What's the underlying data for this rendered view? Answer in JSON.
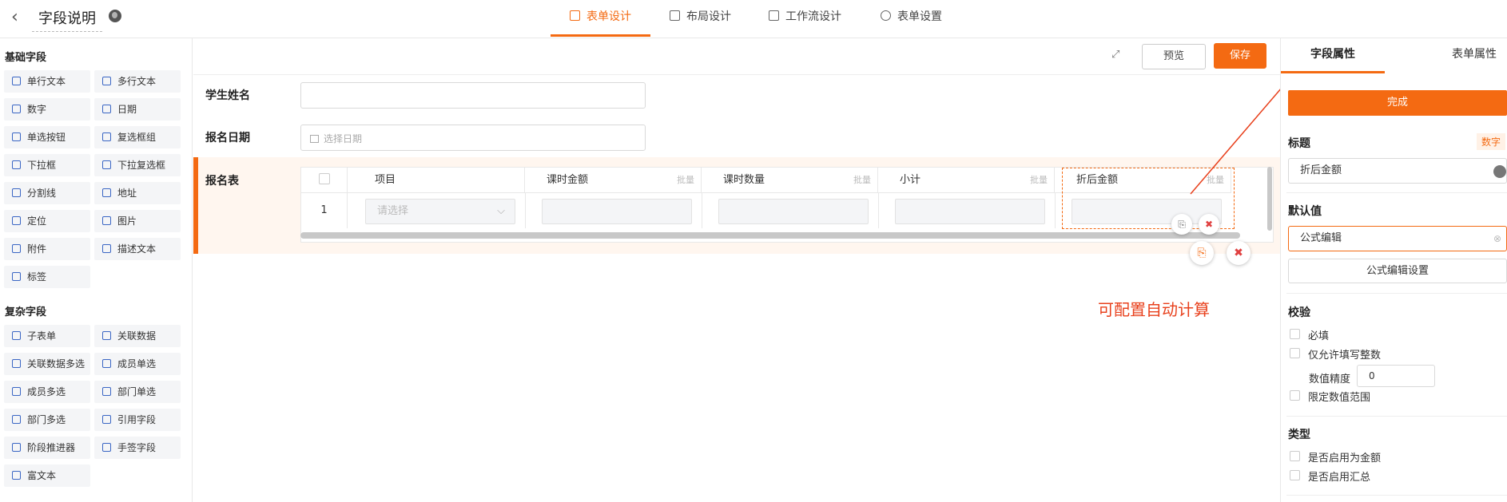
{
  "header": {
    "back_icon": "chevron-left-icon",
    "title": "字段说明",
    "globe_icon": "globe-icon",
    "tabs": [
      {
        "label": "表单设计",
        "icon": "form-icon",
        "active": true
      },
      {
        "label": "布局设计",
        "icon": "layout-icon",
        "active": false
      },
      {
        "label": "工作流设计",
        "icon": "workflow-icon",
        "active": false
      },
      {
        "label": "表单设置",
        "icon": "gear-icon",
        "active": false
      }
    ]
  },
  "left_panel": {
    "basic_title": "基础字段",
    "basic_fields": [
      "单行文本",
      "多行文本",
      "数字",
      "日期",
      "单选按钮",
      "复选框组",
      "下拉框",
      "下拉复选框",
      "分割线",
      "地址",
      "定位",
      "图片",
      "附件",
      "描述文本",
      "标签"
    ],
    "complex_title": "复杂字段",
    "complex_fields": [
      "子表单",
      "关联数据",
      "关联数据多选",
      "成员单选",
      "成员多选",
      "部门单选",
      "部门多选",
      "引用字段",
      "阶段推进器",
      "手签字段",
      "富文本"
    ]
  },
  "toolbar": {
    "icon": "expand-icon",
    "preview_label": "预览",
    "save_label": "保存"
  },
  "form": {
    "student_name_label": "学生姓名",
    "signup_date_label": "报名日期",
    "date_placeholder": "选择日期",
    "subform_label": "报名表",
    "columns": [
      {
        "label": "项目",
        "batch": ""
      },
      {
        "label": "课时金额",
        "batch": "批量"
      },
      {
        "label": "课时数量",
        "batch": "批量"
      },
      {
        "label": "小计",
        "batch": "批量"
      },
      {
        "label": "折后金额",
        "batch": "批量"
      }
    ],
    "row_number": "1",
    "select_placeholder": "请选择",
    "annotation": "可配置自动计算"
  },
  "right_panel": {
    "tab_field": "字段属性",
    "tab_form": "表单属性",
    "done_label": "完成",
    "title_label": "标题",
    "type_badge": "数字",
    "title_value": "折后金额",
    "default_label": "默认值",
    "default_value": "公式编辑",
    "formula_settings_label": "公式编辑设置",
    "validation_label": "校验",
    "required_label": "必填",
    "integer_only_label": "仅允许填写整数",
    "precision_label": "数值精度",
    "precision_value": "0",
    "limit_range_label": "限定数值范围",
    "type_label": "类型",
    "as_amount_label": "是否启用为金额",
    "enable_sum_label": "是否启用汇总"
  },
  "colors": {
    "accent": "#f46a12",
    "annotation": "#e8401c"
  }
}
